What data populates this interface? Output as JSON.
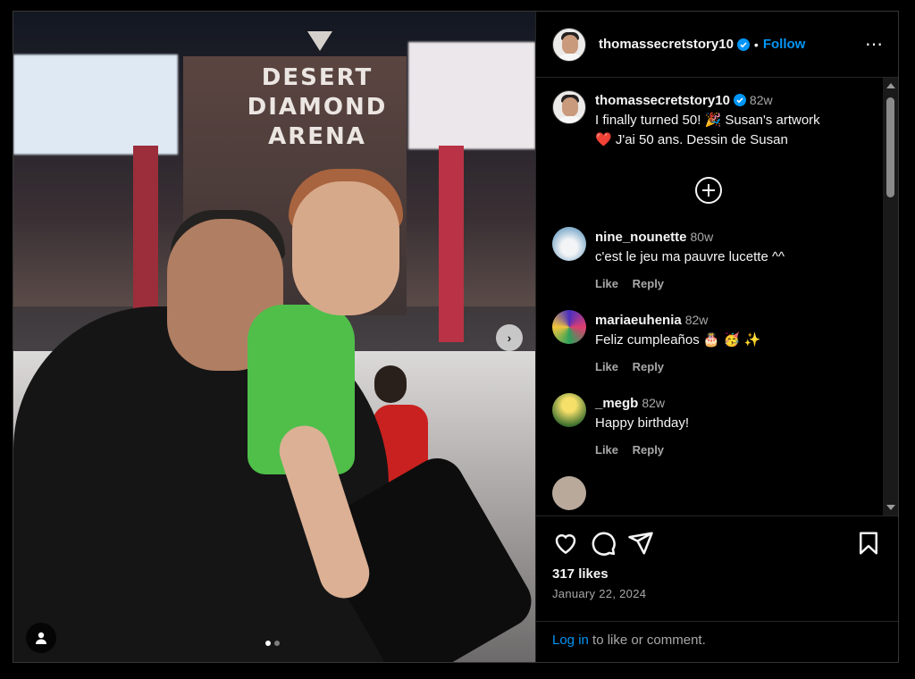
{
  "post": {
    "photo": {
      "sign_lines": [
        "DESERT",
        "DIAMOND",
        "ARENA"
      ],
      "carousel_dots": 2,
      "active_dot": 0
    },
    "author": {
      "username": "thomassecretstory10",
      "verified": true,
      "separator": "•",
      "follow_label": "Follow",
      "more_icon": "⋯"
    },
    "caption": {
      "username": "thomassecretstory10",
      "time": "82w",
      "text_line1": "I finally turned 50! 🎉  Susan's artwork",
      "text_line2": "❤️  J'ai 50 ans. Dessin de Susan"
    },
    "comments": [
      {
        "username": "nine_nounette",
        "time": "80w",
        "text": "c'est le jeu ma pauvre lucette ^^",
        "like_label": "Like",
        "reply_label": "Reply",
        "avatar": "swan"
      },
      {
        "username": "mariaeuhenia",
        "time": "82w",
        "text": "Feliz cumpleaños 🎂 🥳 ✨",
        "like_label": "Like",
        "reply_label": "Reply",
        "avatar": "flower"
      },
      {
        "username": "_megb",
        "time": "82w",
        "text": "Happy birthday!",
        "like_label": "Like",
        "reply_label": "Reply",
        "avatar": "field"
      }
    ],
    "likes": "317 likes",
    "date": "January 22, 2024",
    "login_link": "Log in",
    "login_rest": " to like or comment.",
    "icons": [
      "heart-icon",
      "comment-icon",
      "share-icon",
      "bookmark-icon",
      "add-comments-icon",
      "user-tag-icon",
      "chevron-right-icon"
    ],
    "colors": {
      "accent": "#0095f6",
      "background": "#000000",
      "text": "#f5f5f5",
      "muted": "#a8a8a8"
    }
  }
}
